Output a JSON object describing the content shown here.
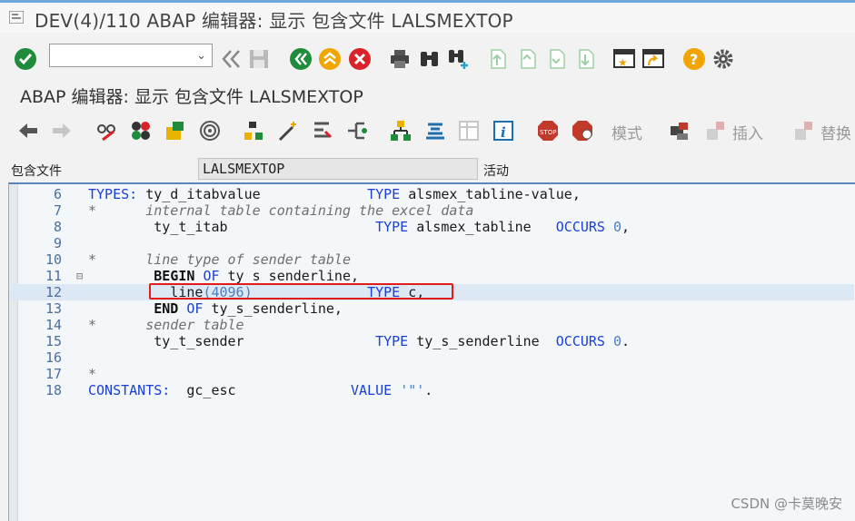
{
  "window": {
    "title": "DEV(4)/110 ABAP 编辑器: 显示 包含文件 LALSMEXTOP"
  },
  "toolbar1": {
    "command_field": {
      "value": "",
      "placeholder": ""
    }
  },
  "page": {
    "subtitle": "ABAP 编辑器: 显示 包含文件 LALSMEXTOP"
  },
  "toolbar2": {
    "mode_label": "模式",
    "insert_label": "插入",
    "replace_label": "替换"
  },
  "include": {
    "label": "包含文件",
    "name": "LALSMEXTOP",
    "status": "活动"
  },
  "editor": {
    "lines": [
      {
        "num": "6",
        "tokens": [
          [
            "k",
            "TYPES: "
          ],
          [
            "n",
            "ty_d_itabvalue             "
          ],
          [
            "k",
            "TYPE "
          ],
          [
            "n",
            "alsmex_tabline-value,"
          ]
        ]
      },
      {
        "num": "7",
        "tokens": [
          [
            "cm",
            "*      internal table containing the excel data"
          ]
        ]
      },
      {
        "num": "8",
        "tokens": [
          [
            "n",
            "        ty_t_itab                  "
          ],
          [
            "k",
            "TYPE "
          ],
          [
            "n",
            "alsmex_tabline   "
          ],
          [
            "k",
            "OCCURS "
          ],
          [
            "num",
            "0"
          ],
          [
            "n",
            ","
          ]
        ]
      },
      {
        "num": "9",
        "tokens": []
      },
      {
        "num": "10",
        "tokens": [
          [
            "cm",
            "*      line type of sender table"
          ]
        ]
      },
      {
        "num": "11",
        "fold": "⊟",
        "tokens": [
          [
            "b",
            "        BEGIN "
          ],
          [
            "k",
            "OF "
          ],
          [
            "n",
            "ty_s_senderline,"
          ]
        ]
      },
      {
        "num": "12",
        "current": true,
        "tokens": [
          [
            "n",
            "          line"
          ],
          [
            "num",
            "(4096)"
          ],
          [
            "n",
            "              "
          ],
          [
            "k",
            "TYPE "
          ],
          [
            "n",
            "c,"
          ]
        ]
      },
      {
        "num": "13",
        "tokens": [
          [
            "b",
            "        END "
          ],
          [
            "k",
            "OF "
          ],
          [
            "n",
            "ty_s_senderline,"
          ]
        ]
      },
      {
        "num": "14",
        "tokens": [
          [
            "cm",
            "*      sender table"
          ]
        ]
      },
      {
        "num": "15",
        "tokens": [
          [
            "n",
            "        ty_t_sender                "
          ],
          [
            "k",
            "TYPE "
          ],
          [
            "n",
            "ty_s_senderline  "
          ],
          [
            "k",
            "OCCURS "
          ],
          [
            "num",
            "0"
          ],
          [
            "n",
            "."
          ]
        ]
      },
      {
        "num": "16",
        "tokens": []
      },
      {
        "num": "17",
        "tokens": [
          [
            "cm",
            "*"
          ]
        ]
      },
      {
        "num": "18",
        "tokens": [
          [
            "k",
            "CONSTANTS:  "
          ],
          [
            "n",
            "gc_esc              "
          ],
          [
            "k",
            "VALUE "
          ],
          [
            "str",
            "'\"'"
          ],
          [
            "n",
            "."
          ]
        ]
      }
    ]
  },
  "watermark": "CSDN @卡莫晚安",
  "colors": {
    "keyword": "#1a3fd6",
    "comment": "#6f6f6f",
    "literal": "#4a7fc1",
    "highlight": "#e21b1b",
    "current_line": "#dde8f5"
  }
}
